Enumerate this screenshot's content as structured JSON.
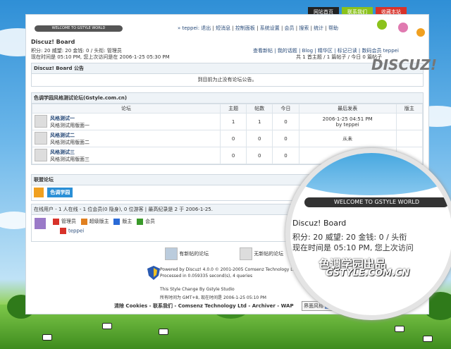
{
  "topnav": {
    "home": "网站首页",
    "contact": "联系我们",
    "favorite": "收藏本站"
  },
  "logo": {
    "text": "DISCUZ!"
  },
  "welcome": "WELCOME TO GSTYLE WORLD",
  "userbar": {
    "greeting": "» teppei: ",
    "links": [
      "退出",
      "短消息",
      "控制面板",
      "系统设置",
      "会员",
      "搜索",
      "统计",
      "帮助"
    ]
  },
  "board": {
    "title": "Discuz! Board",
    "stats": "积分: 20  威望: 20  金钱: 0  / 头衔: 管理员",
    "visit": "现在时间是 05:10 PM, 您上次访问是在 2006-1-25 05:30 PM",
    "rlinks": "查看新帖 | 我的话题 | Blog | 精华区 | 标记已读 | 数码会员 teppei",
    "rstats": "共 1 首主题 / 1 篇帖子 / 今日 0 篇帖子"
  },
  "announce": {
    "title": "Discuz! Board 公告",
    "text": "到目前为止没有论坛公告。"
  },
  "forumgroup": {
    "title": "色调学园风格测试论坛(Gstyle.com.cn)",
    "headers": [
      "论坛",
      "主题",
      "帖数",
      "今日",
      "最后发表",
      "版主"
    ],
    "rows": [
      {
        "name": "风格测试一",
        "desc": "风格测试用版面一",
        "topics": "1",
        "posts": "1",
        "today": "0",
        "last": "2006-1-25 04:51 PM",
        "by": "by teppei"
      },
      {
        "name": "风格测试二",
        "desc": "风格测试用版面二",
        "topics": "0",
        "posts": "0",
        "today": "0",
        "last": "从未",
        "by": ""
      },
      {
        "name": "风格测试三",
        "desc": "风格测试用版面三",
        "topics": "0",
        "posts": "0",
        "today": "0",
        "last": "从未",
        "by": ""
      }
    ]
  },
  "links": {
    "title": "联盟论坛",
    "banner": "色调学园"
  },
  "online": {
    "text": "在线用户 - 1 人在线 - 1 位会员(0 隐身), 0 位游客 | 最高纪录是 2 于 2006-1-25.",
    "legend": [
      "管理员",
      "超级版主",
      "版主",
      "会员"
    ],
    "user": "teppei"
  },
  "icons": {
    "new": "有新帖的论坛",
    "nonew": "无新帖的论坛"
  },
  "footer": {
    "powered": "Powered by Discuz! 4.0.0 © 2001-2005 Comsenz Technology Ltd",
    "processed": "Processed in 0.059335 second(s), 4 queries",
    "style": "This Style Change By Gstyle Studio",
    "time": "所有时间为 GMT+8, 现在时间是 2006-1-25 05:10 PM",
    "links": "清除 Cookies - 联系我们 - Comsenz Technology Ltd - Archiver - WAP",
    "select": "界面风格"
  },
  "lens": {
    "welcome": "WELCOME TO GSTYLE WORLD",
    "title": "Discuz! Board",
    "stats": "积分: 20  威望: 20  金钱: 0  / 头衔",
    "visit": "现在时间是 05:10 PM, 您上次访问",
    "brand": "色调学园出品",
    "url": "GSTYLE.COM.CN"
  }
}
